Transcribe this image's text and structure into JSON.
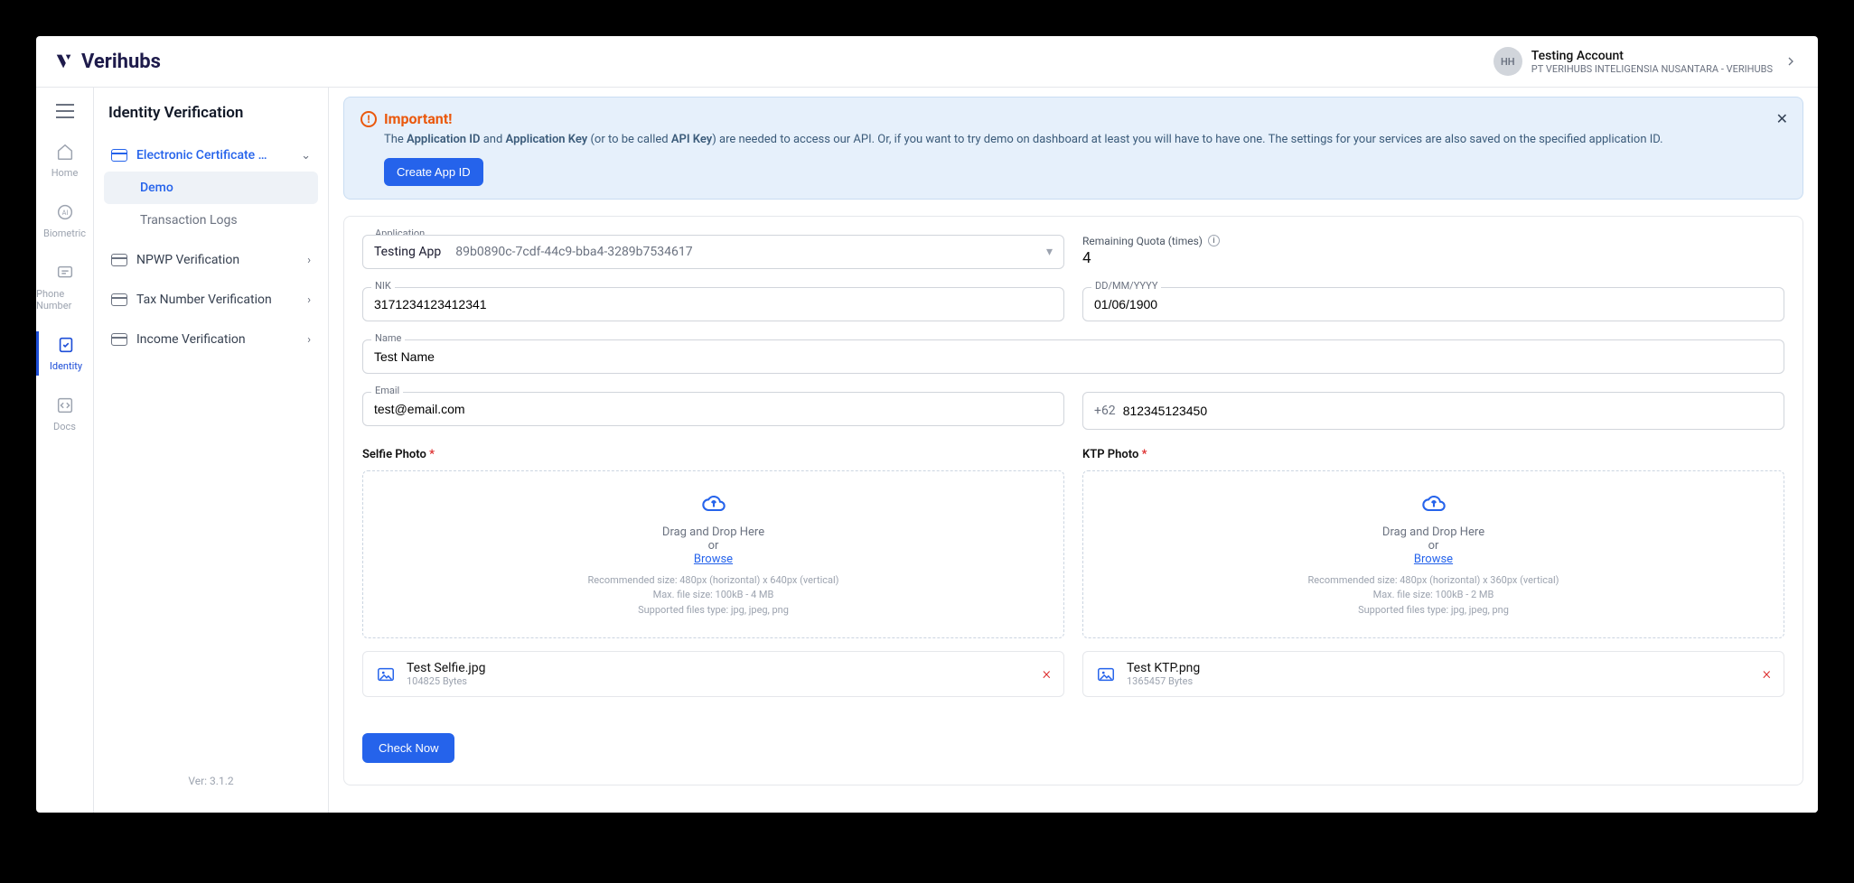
{
  "brand": {
    "name": "Verihubs"
  },
  "account": {
    "initials": "HH",
    "name": "Testing Account",
    "org": "PT VERIHUBS INTELIGENSIA NUSANTARA - VERIHUBS"
  },
  "iconrail": {
    "home": "Home",
    "biometric": "Biometric",
    "phone": "Phone Number",
    "identity": "Identity",
    "docs": "Docs"
  },
  "sidepanel": {
    "title": "Identity Verification",
    "cert_group": "Electronic Certificate …",
    "demo": "Demo",
    "tx_logs": "Transaction Logs",
    "npwp": "NPWP Verification",
    "tax": "Tax Number Verification",
    "income": "Income Verification",
    "version": "Ver: 3.1.2"
  },
  "alert": {
    "title": "Important!",
    "body_pre": "The ",
    "app_id": "Application ID",
    "body_and": " and ",
    "app_key": "Application Key",
    "body_mid": " (or to be called ",
    "api_key": "API Key",
    "body_post": ") are needed to access our API. Or, if you want to try demo on dashboard at least you will have to have one. The settings for your services are also saved on the specified application ID.",
    "create_btn": "Create App ID"
  },
  "form": {
    "app_label": "Application",
    "app_name": "Testing App",
    "app_guid": "89b0890c-7cdf-44c9-bba4-3289b7534617",
    "quota_label": "Remaining Quota (times)",
    "quota_value": "4",
    "nik_label": "NIK",
    "nik_value": "3171234123412341",
    "dob_label": "DD/MM/YYYY",
    "dob_value": "01/06/1900",
    "name_label": "Name",
    "name_value": "Test Name",
    "email_label": "Email",
    "email_value": "test@email.com",
    "phone_cc": "+62",
    "phone_value": "812345123450",
    "selfie_label": "Selfie Photo",
    "ktp_label": "KTP Photo",
    "drop_text1": "Drag and Drop Here",
    "drop_text2": "or",
    "drop_browse": "Browse",
    "selfie_hint1": "Recommended size: 480px (horizontal) x 640px (vertical)",
    "selfie_hint2": "Max. file size: 100kB - 4 MB",
    "selfie_hint3": "Supported files type: jpg, jpeg, png",
    "ktp_hint1": "Recommended size: 480px (horizontal) x 360px (vertical)",
    "ktp_hint2": "Max. file size: 100kB - 2 MB",
    "ktp_hint3": "Supported files type: jpg, jpeg, png",
    "selfie_file_name": "Test Selfie.jpg",
    "selfie_file_size": "104825 Bytes",
    "ktp_file_name": "Test KTP.png",
    "ktp_file_size": "1365457 Bytes",
    "check_btn": "Check Now"
  }
}
